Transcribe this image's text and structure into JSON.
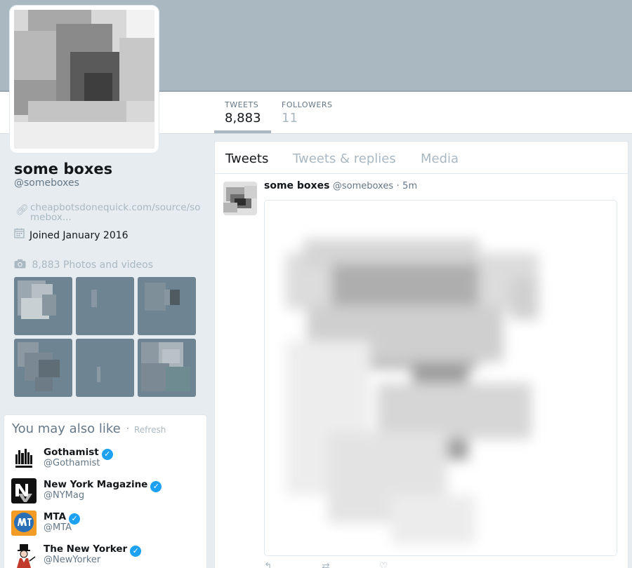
{
  "profile": {
    "name": "some boxes",
    "handle": "@someboxes",
    "url": "cheapbotsdonequick.com/source/somebox...",
    "joined": "Joined January 2016",
    "photos_label": "8,883 Photos and videos"
  },
  "stats": {
    "tweets_label": "TWEETS",
    "tweets_value": "8,883",
    "followers_label": "FOLLOWERS",
    "followers_value": "11"
  },
  "tabs": {
    "tweets": "Tweets",
    "replies": "Tweets & replies",
    "media": "Media"
  },
  "tweet": {
    "name": "some boxes",
    "handle": "@someboxes",
    "separator": "·",
    "time": "5m"
  },
  "suggestions": {
    "title": "You may also like",
    "separator": "·",
    "refresh": "Refresh",
    "items": [
      {
        "name": "Gothamist",
        "handle": "@Gothamist"
      },
      {
        "name": "New York Magazine",
        "handle": "@NYMag"
      },
      {
        "name": "MTA",
        "handle": "@MTA"
      },
      {
        "name": "The New Yorker",
        "handle": "@NewYorker"
      }
    ]
  },
  "icons": {
    "link": "link-icon",
    "calendar": "calendar-icon",
    "camera": "camera-icon",
    "verified": "verified-badge-icon"
  },
  "colors": {
    "banner": "#aab8c2",
    "page_background": "#e6ecf0",
    "verified": "#1da1f2",
    "muted_text": "#aab8c2"
  }
}
